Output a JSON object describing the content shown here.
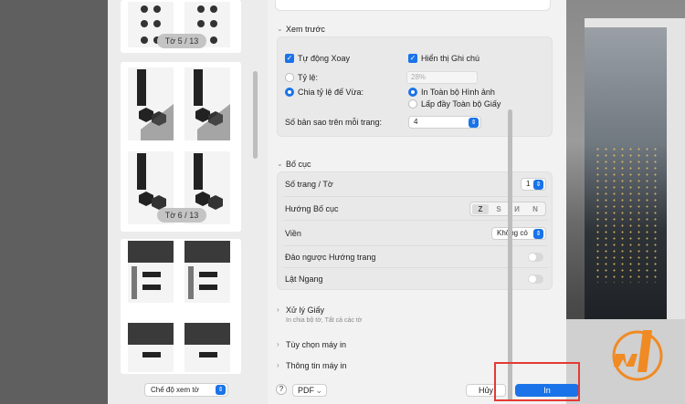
{
  "thumbnails": {
    "sheet5_label": "Tờ 5 / 13",
    "sheet6_label": "Tờ 6 / 13",
    "view_mode": "Chế độ xem tờ"
  },
  "preview": {
    "title": "Xem trước",
    "auto_rotate": "Tự động Xoay",
    "show_notes": "Hiển thị Ghi chú",
    "scale_label": "Tỷ lệ:",
    "scale_value": "28%",
    "fit_label": "Chia tỷ lệ để Vừa:",
    "print_entire_image": "In Toàn bộ Hình ảnh",
    "fill_entire_paper": "Lấp đầy Toàn bộ Giấy",
    "copies_per_page_label": "Số bản sao trên mỗi trang:",
    "copies_per_page_value": "4"
  },
  "layout": {
    "title": "Bố cục",
    "pages_per_sheet_label": "Số trang / Tờ",
    "pages_per_sheet_value": "1",
    "layout_direction_label": "Hướng Bố cục",
    "direction_glyphs": [
      "Z",
      "S",
      "И",
      "N"
    ],
    "border_label": "Viền",
    "border_value": "Không có",
    "reverse_orientation_label": "Đảo ngược Hướng trang",
    "flip_horizontal_label": "Lật Ngang"
  },
  "paper_handling": {
    "title": "Xử lý Giấy",
    "subtitle": "In chia bộ tờ, Tất cả các tờ"
  },
  "printer_options": {
    "title": "Tùy chọn máy in"
  },
  "printer_info": {
    "title": "Thông tin máy in"
  },
  "footer": {
    "help": "?",
    "pdf": "PDF",
    "cancel": "Hủy",
    "print": "In"
  },
  "colors": {
    "accent": "#1a73e8",
    "highlight": "#e53935"
  }
}
